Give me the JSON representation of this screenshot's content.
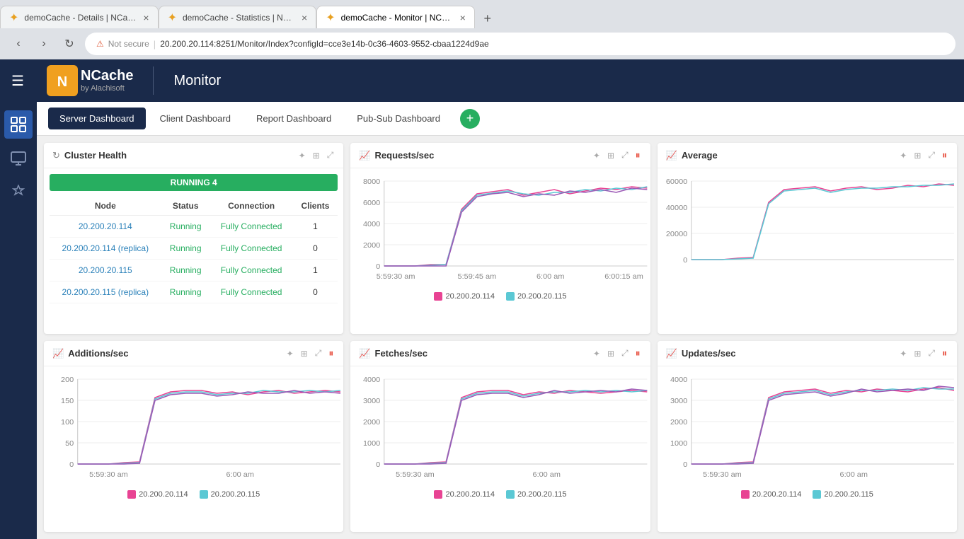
{
  "browser": {
    "tabs": [
      {
        "id": "tab1",
        "label": "demoCache - Details | NCache",
        "active": false
      },
      {
        "id": "tab2",
        "label": "demoCache - Statistics | NCache",
        "active": false
      },
      {
        "id": "tab3",
        "label": "demoCache - Monitor | NCache",
        "active": true
      }
    ],
    "address": "20.200.20.114:8251/Monitor/Index?configId=cce3e14b-0c36-4603-9552-cbaa1224d9ae",
    "security_warning": "Not secure"
  },
  "app": {
    "title": "Monitor",
    "logo_text": "NCache",
    "logo_sub": "by Alachisoft"
  },
  "sidebar": {
    "items": [
      {
        "id": "dashboard",
        "icon": "⊞",
        "active": true
      },
      {
        "id": "monitor",
        "icon": "🖥",
        "active": false
      },
      {
        "id": "tools",
        "icon": "🔧",
        "active": false
      }
    ]
  },
  "dashboard_tabs": {
    "tabs": [
      {
        "id": "server",
        "label": "Server Dashboard",
        "active": true
      },
      {
        "id": "client",
        "label": "Client Dashboard",
        "active": false
      },
      {
        "id": "report",
        "label": "Report Dashboard",
        "active": false
      },
      {
        "id": "pubsub",
        "label": "Pub-Sub Dashboard",
        "active": false
      }
    ]
  },
  "cluster_health": {
    "title": "Cluster Health",
    "status": "RUNNING 4",
    "columns": [
      "Node",
      "Status",
      "Connection",
      "Clients"
    ],
    "rows": [
      {
        "node": "20.200.20.114",
        "status": "Running",
        "connection": "Fully Connected",
        "clients": "1"
      },
      {
        "node": "20.200.20.114 (replica)",
        "status": "Running",
        "connection": "Fully Connected",
        "clients": "0"
      },
      {
        "node": "20.200.20.115",
        "status": "Running",
        "connection": "Fully Connected",
        "clients": "1"
      },
      {
        "node": "20.200.20.115 (replica)",
        "status": "Running",
        "connection": "Fully Connected",
        "clients": "0"
      }
    ]
  },
  "charts": {
    "requests": {
      "title": "Requests/sec",
      "y_labels": [
        "8000",
        "6000",
        "4000",
        "2000",
        "0"
      ],
      "x_labels": [
        "5:59:30 am",
        "5:59:45 am",
        "6:00 am",
        "6:00:15 am"
      ],
      "legend": [
        "20.200.20.114",
        "20.200.20.115"
      ]
    },
    "average": {
      "title": "Average",
      "y_labels": [
        "60000",
        "40000",
        "20000",
        "0"
      ],
      "x_labels": []
    },
    "additions": {
      "title": "Additions/sec",
      "y_labels": [
        "200",
        "150",
        "100",
        "50",
        "0"
      ],
      "x_labels": [
        "5:59:30 am",
        "6:00 am"
      ],
      "legend": [
        "20.200.20.114",
        "20.200.20.115"
      ]
    },
    "fetches": {
      "title": "Fetches/sec",
      "y_labels": [
        "4000",
        "3000",
        "2000",
        "1000",
        "0"
      ],
      "x_labels": [
        "5:59:30 am",
        "6:00 am"
      ],
      "legend": [
        "20.200.20.114",
        "20.200.20.115"
      ]
    },
    "updates": {
      "title": "Updates/sec",
      "y_labels": [
        "4000",
        "3000",
        "2000",
        "1000",
        "0"
      ],
      "x_labels": [
        "5:59:30 am",
        "6:00 am"
      ],
      "legend": [
        "20.200.20.114",
        "20.200.20.115"
      ]
    }
  },
  "colors": {
    "nav_bg": "#1a2a4a",
    "accent": "#2980b9",
    "success": "#27ae60",
    "danger": "#e74c3c",
    "line1": "#e84393",
    "line2": "#5bc8d4"
  }
}
